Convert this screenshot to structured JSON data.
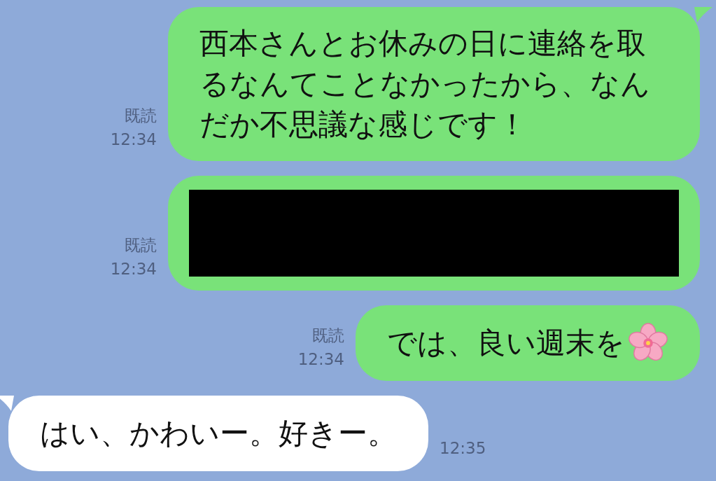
{
  "messages": [
    {
      "kind": "sent",
      "tail": true,
      "read": "既読",
      "time": "12:34",
      "text": "西本さんとお休みの日に連絡を取るなんてことなかったから、なんだか不思議な感じです！"
    },
    {
      "kind": "redacted",
      "tail": false,
      "read": "既読",
      "time": "12:34"
    },
    {
      "kind": "blossom",
      "tail": false,
      "read": "既読",
      "time": "12:34",
      "text": "では、良い週末を"
    },
    {
      "kind": "received",
      "tail": true,
      "time": "12:35",
      "text": "はい、かわいー。好きー。"
    }
  ]
}
